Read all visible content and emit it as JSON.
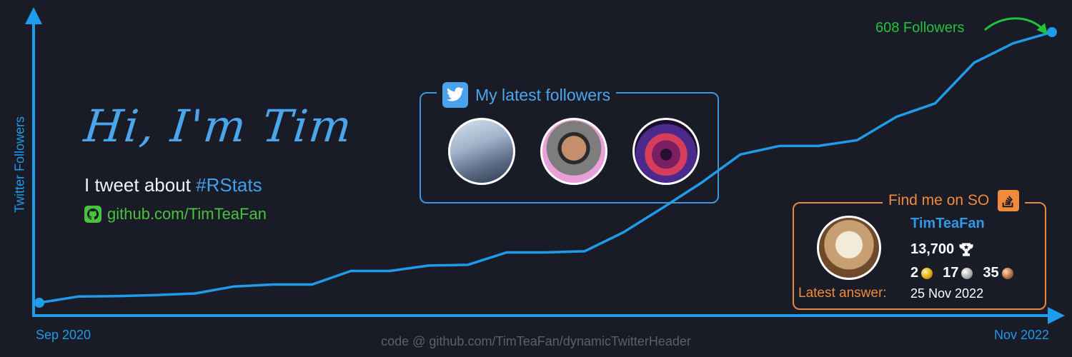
{
  "chart_data": {
    "type": "line",
    "x": [
      "Sep 2020",
      "",
      "",
      "",
      "",
      "",
      "",
      "",
      "",
      "",
      "",
      "",
      "",
      "",
      "",
      "",
      "",
      "",
      "",
      "",
      "",
      "",
      "",
      "",
      "",
      "",
      "Nov 2022"
    ],
    "y": [
      0,
      16,
      17,
      20,
      24,
      42,
      47,
      47,
      82,
      82,
      96,
      98,
      130,
      130,
      133,
      182,
      245,
      310,
      383,
      405,
      405,
      420,
      480,
      515,
      620,
      670,
      608
    ],
    "y_note": "",
    "ylabel": "Twitter Followers",
    "xtick_start": "Sep 2020",
    "xtick_end": "Nov 2022",
    "annotation": "608 Followers",
    "line_color": "#1e9be9",
    "annotation_color": "#20c43b"
  },
  "intro": {
    "greeting": "Hi, I'm Tim",
    "tagline_prefix": "I tweet about ",
    "tagline_hashtag": "#RStats",
    "github_link": "github.com/TimTeaFan",
    "github_icon": "github-icon"
  },
  "twitter_box": {
    "title": "My latest followers",
    "icon": "twitter-bird-icon",
    "border_color": "#3b96dd"
  },
  "so_box": {
    "title": "Find me on SO",
    "icon": "stackoverflow-icon",
    "username": "TimTeaFan",
    "reputation": "13,700",
    "gold": "2",
    "silver": "17",
    "bronze": "35",
    "latest_label": "Latest answer:",
    "latest_date": "25 Nov 2022",
    "border_color": "#e88a3d"
  },
  "footer": "code @ github.com/TimTeaFan/dynamicTwitterHeader"
}
